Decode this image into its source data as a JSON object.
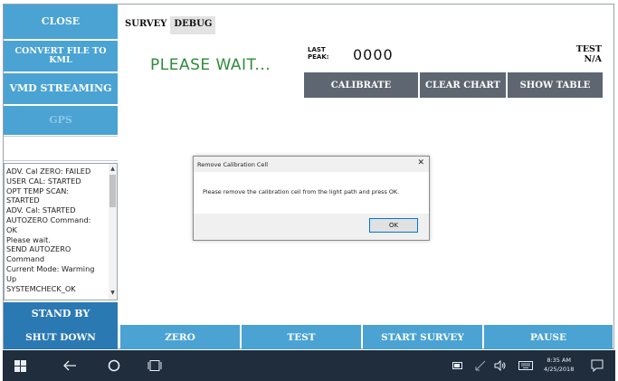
{
  "sidebar": {
    "close": "CLOSE",
    "convert_kml": "CONVERT FILE TO KML",
    "vmd_streaming": "VMD STREAMING",
    "gps": "GPS",
    "log_lines": [
      "ADV. Cal ZERO: FAILED",
      "USER CAL: STARTED",
      "OPT TEMP SCAN:",
      "STARTED",
      "ADV. Cal: STARTED",
      "AUTOZERO Command:",
      "OK",
      "Please wait.",
      "SEND AUTOZERO",
      "Command",
      "Current Mode: Warming",
      "Up",
      "SYSTEMCHECK_OK"
    ],
    "stand_by": "STAND BY",
    "shut_down": "SHUT DOWN"
  },
  "tabs": [
    "SURVEY",
    "DEBUG"
  ],
  "status": {
    "message": "PLEASE WAIT...",
    "last_peak_label_1": "LAST",
    "last_peak_label_2": "PEAK:",
    "last_peak_value": "0000",
    "test_label": "TEST",
    "test_value": "N/A"
  },
  "actions": {
    "calibrate": "CALIBRATE",
    "clear_chart": "CLEAR CHART",
    "show_table": "SHOW TABLE"
  },
  "dialog": {
    "title": "Remove Calibration Cell",
    "close_glyph": "✕",
    "message": "Please remove the calibration cell from the light path and press OK.",
    "ok": "OK"
  },
  "bottom_bar": {
    "zero": "ZERO",
    "test": "TEST",
    "start_survey": "START SURVEY",
    "pause": "PAUSE"
  },
  "taskbar": {
    "time": "8:35 AM",
    "date": "4/25/2018",
    "icons": [
      "windows-start-icon",
      "back-arrow-icon",
      "search-circle-icon",
      "task-view-icon",
      "battery-icon",
      "wifi-icon",
      "volume-icon",
      "keyboard-icon",
      "action-center-icon"
    ]
  },
  "colors": {
    "sidebar_button": "#4aa3d3",
    "action_button": "#5d6671",
    "status_text": "#2e8b3a",
    "taskbar": "#1f2d3d"
  }
}
